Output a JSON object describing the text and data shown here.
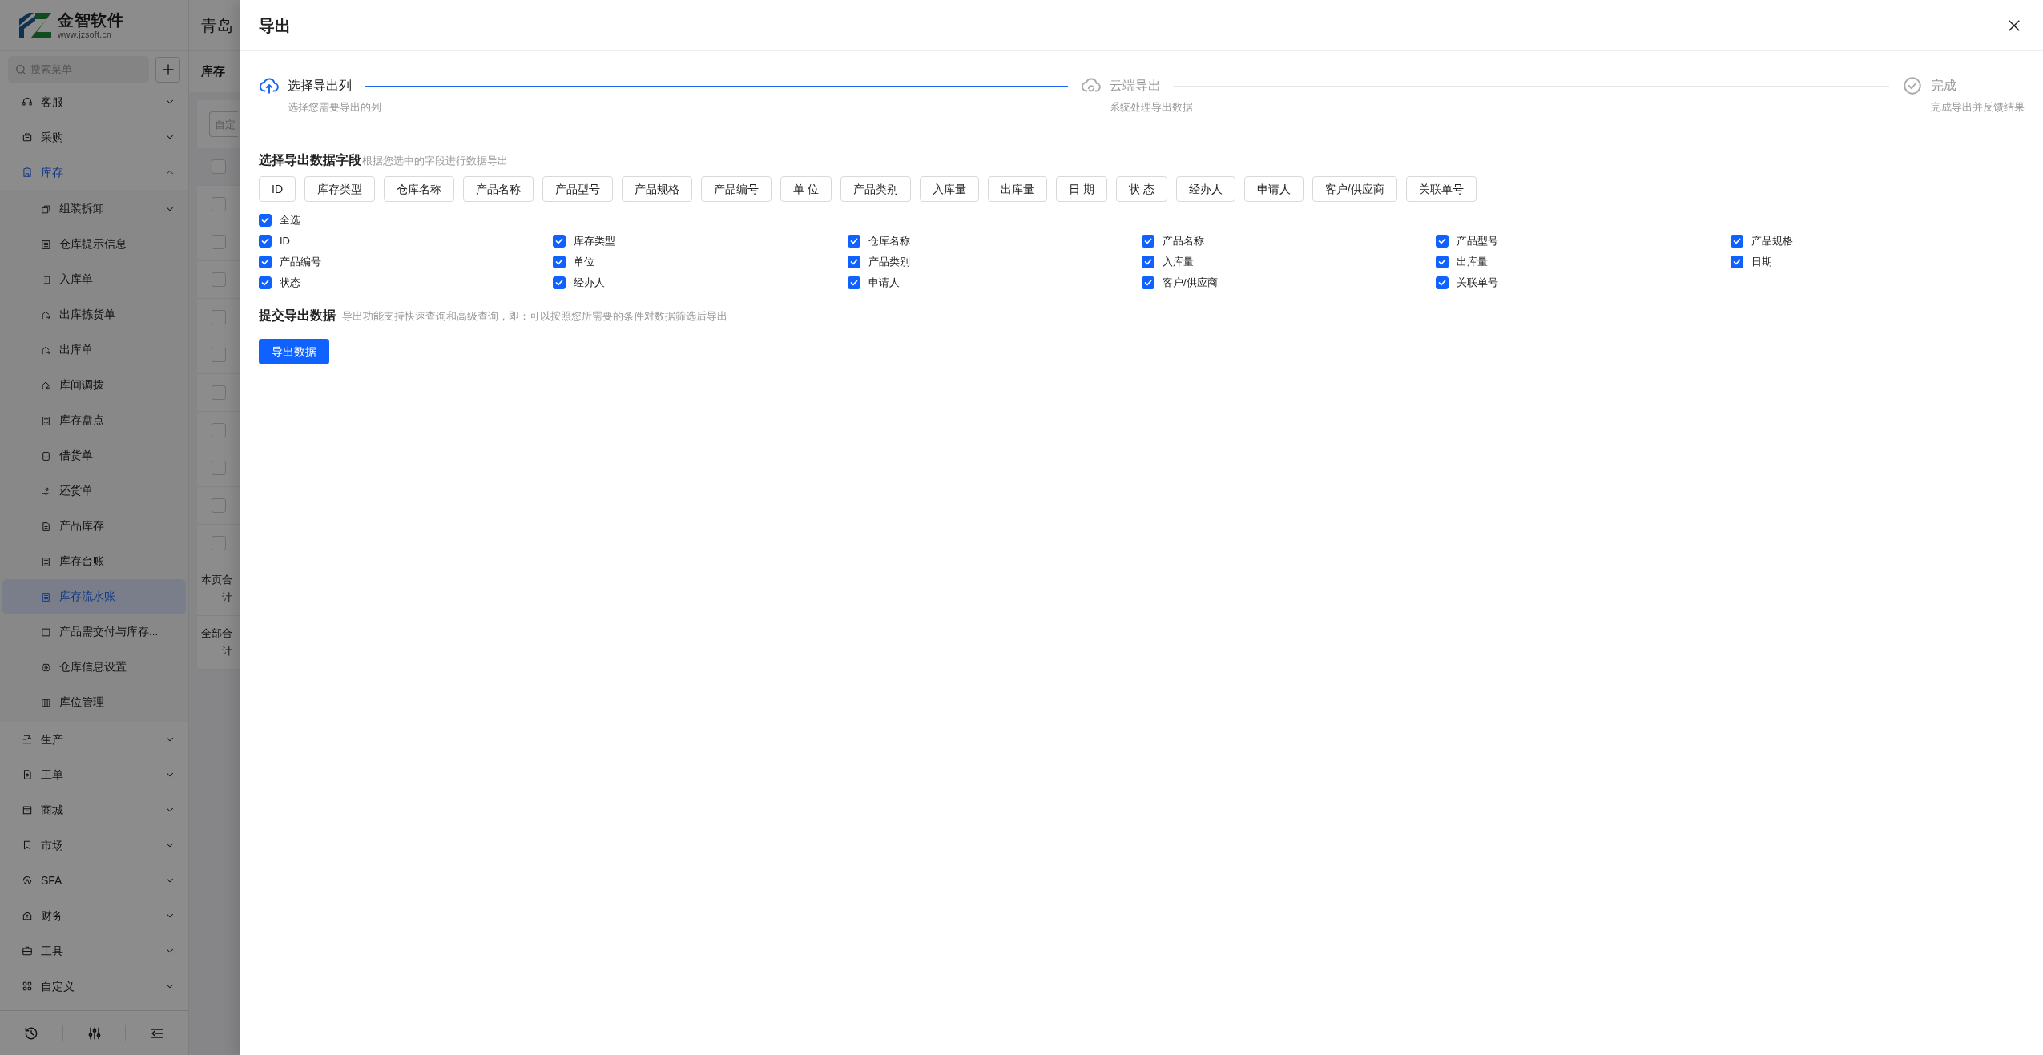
{
  "app": {
    "logo_title": "金智软件",
    "logo_url": "www.jzsoft.cn",
    "company": "青岛",
    "search_placeholder": "搜索菜单"
  },
  "sidebar": {
    "menu": [
      {
        "label": "客服",
        "active": false,
        "expanded": false
      },
      {
        "label": "采购",
        "active": false,
        "expanded": false
      },
      {
        "label": "库存",
        "active": true,
        "expanded": true,
        "children": [
          {
            "label": "组装拆卸",
            "selected": false,
            "expanded": false
          },
          {
            "label": "仓库提示信息",
            "selected": false
          },
          {
            "label": "入库单",
            "selected": false
          },
          {
            "label": "出库拣货单",
            "selected": false
          },
          {
            "label": "出库单",
            "selected": false
          },
          {
            "label": "库间调拨",
            "selected": false
          },
          {
            "label": "库存盘点",
            "selected": false
          },
          {
            "label": "借货单",
            "selected": false
          },
          {
            "label": "还货单",
            "selected": false
          },
          {
            "label": "产品库存",
            "selected": false
          },
          {
            "label": "库存台账",
            "selected": false
          },
          {
            "label": "库存流水账",
            "selected": true
          },
          {
            "label": "产品需交付与库存...",
            "selected": false
          },
          {
            "label": "仓库信息设置",
            "selected": false
          },
          {
            "label": "库位管理",
            "selected": false
          }
        ]
      },
      {
        "label": "生产",
        "active": false,
        "expanded": false
      },
      {
        "label": "工单",
        "active": false,
        "expanded": false
      },
      {
        "label": "商城",
        "active": false,
        "expanded": false
      },
      {
        "label": "市场",
        "active": false,
        "expanded": false
      },
      {
        "label": "SFA",
        "active": false,
        "expanded": false
      },
      {
        "label": "财务",
        "active": false,
        "expanded": false
      },
      {
        "label": "工具",
        "active": false,
        "expanded": false
      },
      {
        "label": "自定义",
        "active": false,
        "expanded": false
      }
    ]
  },
  "page": {
    "title": "库存",
    "filter_placeholder": "自定",
    "table": {
      "rows": [
        {
          "checked": false
        },
        {
          "checked": false
        },
        {
          "checked": false
        },
        {
          "checked": false
        },
        {
          "checked": false
        },
        {
          "checked": false
        },
        {
          "checked": false
        },
        {
          "checked": false
        },
        {
          "checked": false
        },
        {
          "checked": false
        },
        {
          "checked": false
        }
      ],
      "summary": [
        "本页合计",
        "全部合计"
      ]
    }
  },
  "drawer": {
    "title": "导出",
    "steps": [
      {
        "title": "选择导出列",
        "description": "选择您需要导出的列",
        "active": true
      },
      {
        "title": "云端导出",
        "description": "系统处理导出数据",
        "active": false
      },
      {
        "title": "完成",
        "description": "完成导出并反馈结果",
        "active": false
      }
    ],
    "field_section": {
      "title": "选择导出数据字段",
      "hint": "根据您选中的字段进行数据导出",
      "tags": [
        "ID",
        "库存类型",
        "仓库名称",
        "产品名称",
        "产品型号",
        "产品规格",
        "产品编号",
        "单 位",
        "产品类别",
        "入库量",
        "出库量",
        "日 期",
        "状 态",
        "经办人",
        "申请人",
        "客户/供应商",
        "关联单号"
      ],
      "select_all": {
        "label": "全选",
        "checked": true
      },
      "fields": [
        {
          "label": "ID",
          "checked": true
        },
        {
          "label": "库存类型",
          "checked": true
        },
        {
          "label": "仓库名称",
          "checked": true
        },
        {
          "label": "产品名称",
          "checked": true
        },
        {
          "label": "产品型号",
          "checked": true
        },
        {
          "label": "产品规格",
          "checked": true
        },
        {
          "label": "产品编号",
          "checked": true
        },
        {
          "label": "单位",
          "checked": true
        },
        {
          "label": "产品类别",
          "checked": true
        },
        {
          "label": "入库量",
          "checked": true
        },
        {
          "label": "出库量",
          "checked": true
        },
        {
          "label": "日期",
          "checked": true
        },
        {
          "label": "状态",
          "checked": true
        },
        {
          "label": "经办人",
          "checked": true
        },
        {
          "label": "申请人",
          "checked": true
        },
        {
          "label": "客户/供应商",
          "checked": true
        },
        {
          "label": "关联单号",
          "checked": true
        }
      ]
    },
    "submit_section": {
      "title": "提交导出数据",
      "hint": "导出功能支持快速查询和高级查询，即：可以按照您所需要的条件对数据筛选后导出",
      "button": "导出数据"
    }
  }
}
